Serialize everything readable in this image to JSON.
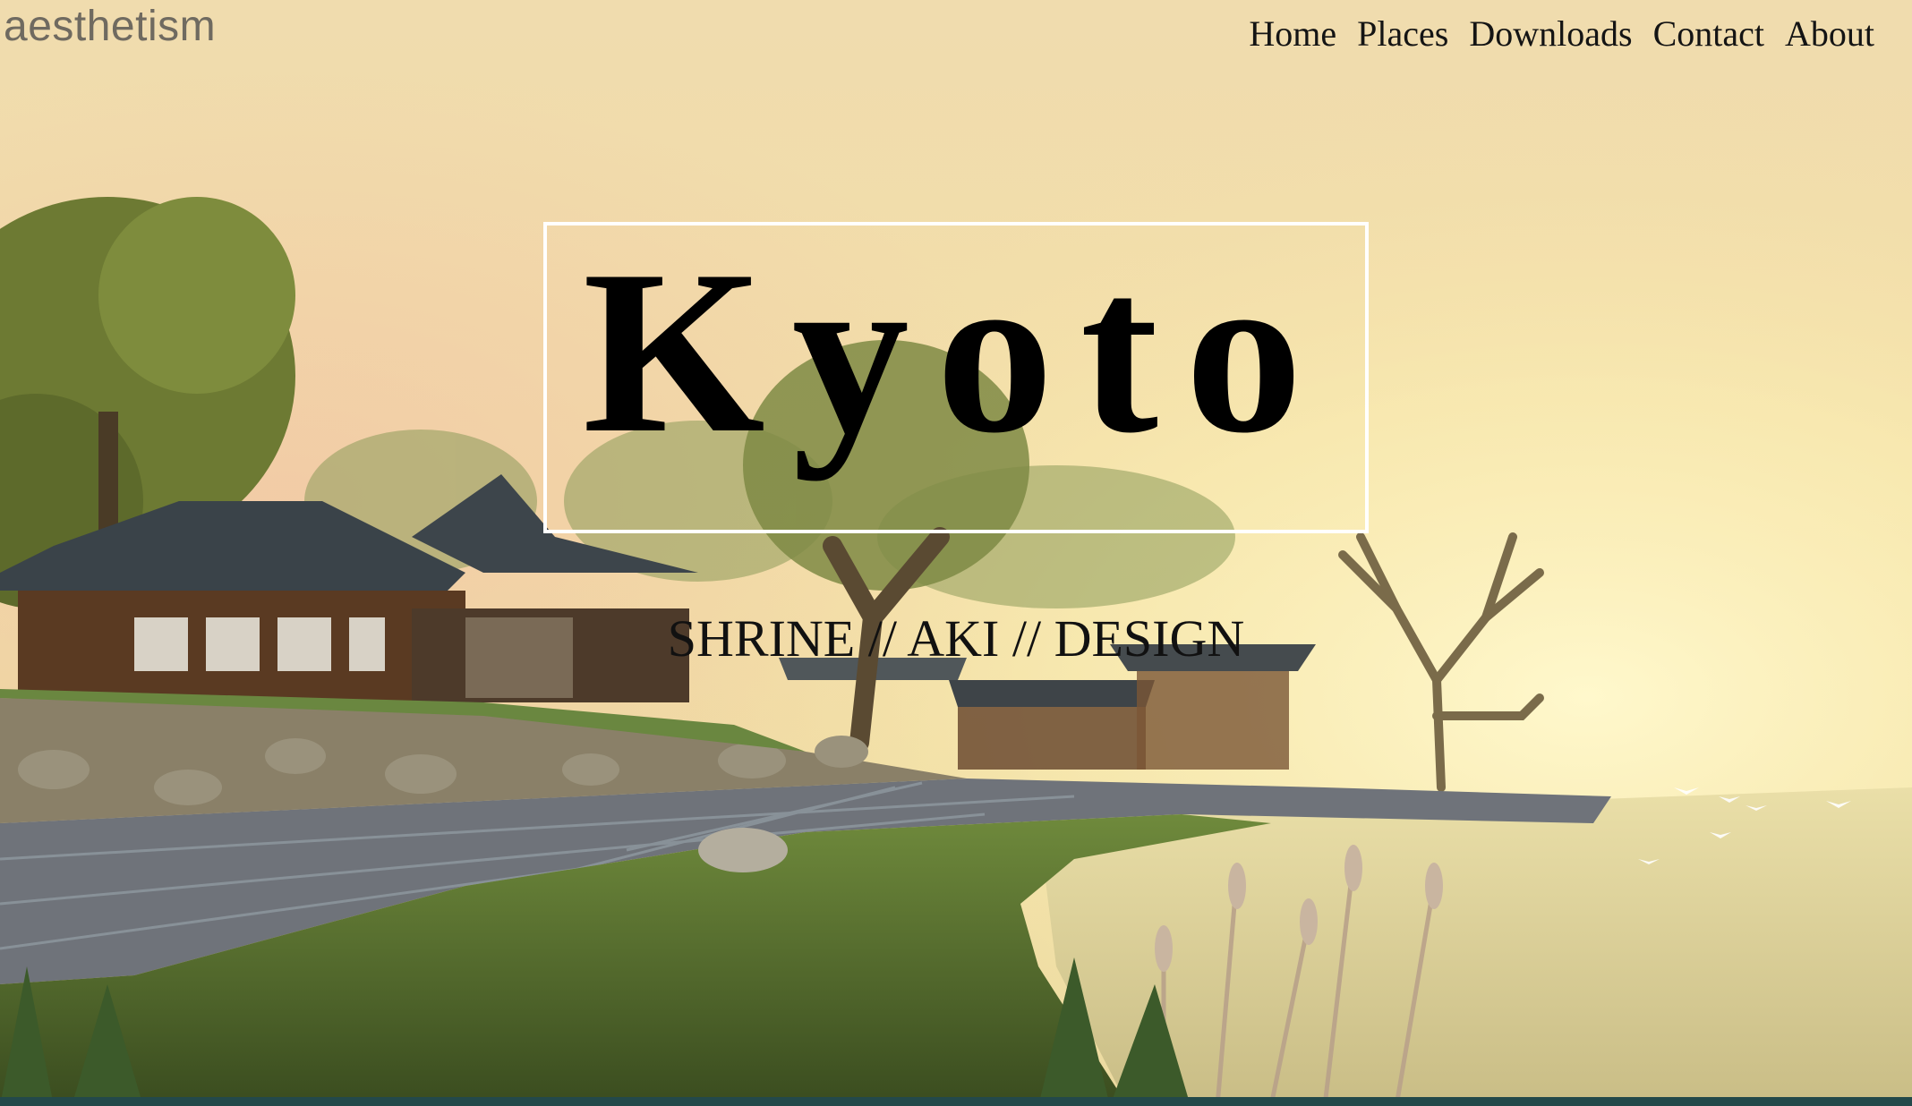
{
  "site": {
    "brand": "aesthetism"
  },
  "nav": {
    "items": [
      "Home",
      "Places",
      "Downloads",
      "Contact",
      "About"
    ]
  },
  "hero": {
    "title": "Kyoto",
    "subtitle": "SHRINE // AKI // DESIGN"
  },
  "colors": {
    "sky_top": "#f2dfb2",
    "sky_glow": "#fff3b8",
    "bottom_strip": "#23494a",
    "title_border": "#ffffff"
  }
}
